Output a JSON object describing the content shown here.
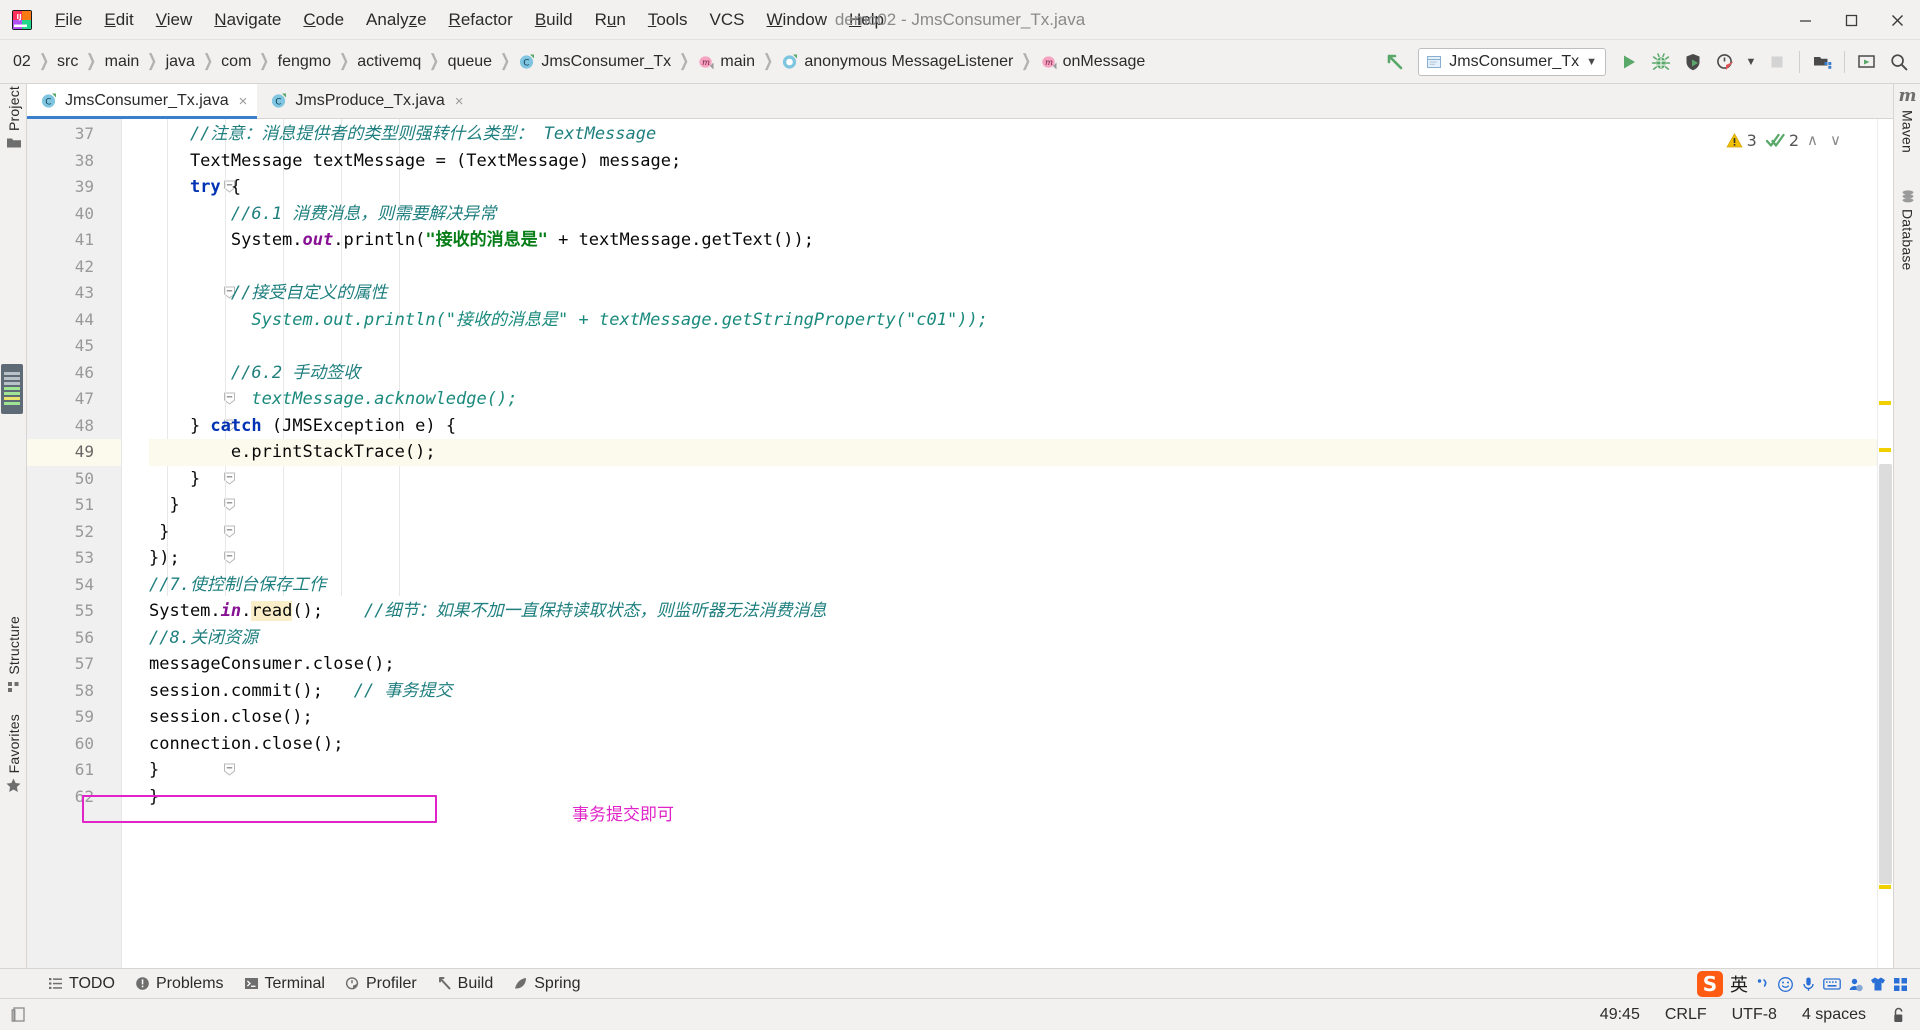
{
  "window": {
    "title": "demo02 - JmsConsumer_Tx.java",
    "logo_icon": "intellij-idea-logo",
    "minimize_icon": "—",
    "maximize_icon": "❐",
    "close_icon": "✕"
  },
  "menubar": {
    "items": [
      {
        "label": "File",
        "mnemonic": "F"
      },
      {
        "label": "Edit",
        "mnemonic": "E"
      },
      {
        "label": "View",
        "mnemonic": "V"
      },
      {
        "label": "Navigate",
        "mnemonic": "N"
      },
      {
        "label": "Code",
        "mnemonic": "C"
      },
      {
        "label": "Analyze",
        "mnemonic": "z"
      },
      {
        "label": "Refactor",
        "mnemonic": "R"
      },
      {
        "label": "Build",
        "mnemonic": "B"
      },
      {
        "label": "Run",
        "mnemonic": "u"
      },
      {
        "label": "Tools",
        "mnemonic": "T"
      },
      {
        "label": "VCS",
        "mnemonic": ""
      },
      {
        "label": "Window",
        "mnemonic": "W"
      },
      {
        "label": "Help",
        "mnemonic": "H"
      }
    ]
  },
  "breadcrumb": {
    "items": [
      {
        "label": "02",
        "icon": ""
      },
      {
        "label": "src",
        "icon": ""
      },
      {
        "label": "main",
        "icon": ""
      },
      {
        "label": "java",
        "icon": ""
      },
      {
        "label": "com",
        "icon": ""
      },
      {
        "label": "fengmo",
        "icon": ""
      },
      {
        "label": "activemq",
        "icon": ""
      },
      {
        "label": "queue",
        "icon": ""
      },
      {
        "label": "JmsConsumer_Tx",
        "icon": "class-icon"
      },
      {
        "label": "main",
        "icon": "method-icon"
      },
      {
        "label": "anonymous MessageListener",
        "icon": "anonymous-class-icon"
      },
      {
        "label": "onMessage",
        "icon": "method-icon"
      }
    ]
  },
  "toolbar": {
    "back_arrow_icon": "back-arrow-icon",
    "run_config": {
      "label": "JmsConsumer_Tx",
      "icon": "run-config-icon",
      "dropdown_icon": "▼"
    },
    "buttons": [
      {
        "name": "run-button",
        "icon": "▶",
        "color": "#59a869"
      },
      {
        "name": "debug-button",
        "icon": "bug-icon",
        "color": "#59a869"
      },
      {
        "name": "run-coverage-button",
        "icon": "coverage-icon",
        "color": "#4a4a4a"
      },
      {
        "name": "profile-button",
        "icon": "profiler-icon",
        "color": "#4a4a4a"
      },
      {
        "name": "profile-dropdown",
        "icon": "▾",
        "color": "#4a4a4a"
      },
      {
        "name": "stop-button",
        "icon": "■",
        "color": "#b0b0b0"
      },
      {
        "name": "project-structure-button",
        "icon": "project-structure-icon",
        "color": "#4a4a4a"
      },
      {
        "name": "update-project-button",
        "icon": "update-icon",
        "color": "#4a4a4a"
      },
      {
        "name": "search-everywhere-button",
        "icon": "search-icon",
        "color": "#4a4a4a"
      }
    ]
  },
  "left_tool_window": {
    "items": [
      {
        "label": "Project",
        "icon": "folder-icon"
      },
      {
        "label": "Structure",
        "icon": "structure-icon"
      },
      {
        "label": "Favorites",
        "icon": "star-icon"
      }
    ]
  },
  "right_tool_window": {
    "items": [
      {
        "label": "Maven",
        "icon": "maven-icon"
      },
      {
        "label": "Database",
        "icon": "database-icon"
      }
    ]
  },
  "editor_tabs": [
    {
      "label": "JmsConsumer_Tx.java",
      "icon": "java-class-icon",
      "active": true,
      "close_icon": "×"
    },
    {
      "label": "JmsProduce_Tx.java",
      "icon": "java-class-icon",
      "active": false,
      "close_icon": "×"
    }
  ],
  "inspections": {
    "warning_icon": "warning-triangle-icon",
    "warning_count": "3",
    "ok_icon": "double-check-icon",
    "ok_count": "2",
    "prev_icon": "∧",
    "next_icon": "∨"
  },
  "editor": {
    "first_line": 37,
    "caret_position": "49:45",
    "highlighted_line": 49,
    "lines": [
      {
        "n": 37,
        "fold": false,
        "indent": 0,
        "tokens": [
          {
            "t": "    //注意：消息提供者的类型则强转什么类型： TextMessage",
            "c": "c-cmt"
          }
        ]
      },
      {
        "n": 38,
        "fold": false,
        "indent": 0,
        "tokens": [
          {
            "t": "    TextMessage textMessage = (TextMessage) message;",
            "c": "c-txt"
          }
        ]
      },
      {
        "n": 39,
        "fold": true,
        "indent": 0,
        "tokens": [
          {
            "t": "    ",
            "c": "c-txt"
          },
          {
            "t": "try",
            "c": "c-kw"
          },
          {
            "t": " {",
            "c": "c-txt"
          }
        ]
      },
      {
        "n": 40,
        "fold": false,
        "indent": 0,
        "tokens": [
          {
            "t": "        //6.1 消费消息，则需要解决异常",
            "c": "c-cmt"
          }
        ]
      },
      {
        "n": 41,
        "fold": false,
        "indent": 0,
        "tokens": [
          {
            "t": "        System.",
            "c": "c-txt"
          },
          {
            "t": "out",
            "c": "c-fld"
          },
          {
            "t": ".println(",
            "c": "c-txt"
          },
          {
            "t": "\"接收的消息是\"",
            "c": "c-str"
          },
          {
            "t": " + textMessage.getText());",
            "c": "c-txt"
          }
        ]
      },
      {
        "n": 42,
        "fold": false,
        "indent": 0,
        "tokens": []
      },
      {
        "n": 43,
        "fold": true,
        "indent": 0,
        "tokens": [
          {
            "t": "        //接受自定义的属性",
            "c": "c-cmt"
          }
        ]
      },
      {
        "n": 44,
        "fold": false,
        "comment_marker": "//",
        "indent": 0,
        "tokens": [
          {
            "t": "          System.out.println(\"接收的消息是\" + textMessage.getStringProperty(\"c01\"));",
            "c": "c-ccode"
          }
        ]
      },
      {
        "n": 45,
        "fold": false,
        "indent": 0,
        "tokens": []
      },
      {
        "n": 46,
        "fold": false,
        "indent": 0,
        "tokens": [
          {
            "t": "        //6.2 手动签收",
            "c": "c-cmt"
          }
        ]
      },
      {
        "n": 47,
        "fold": true,
        "comment_marker": "//",
        "indent": 0,
        "tokens": [
          {
            "t": "          textMessage.acknowledge();",
            "c": "c-ccode"
          }
        ]
      },
      {
        "n": 48,
        "fold": true,
        "indent": 0,
        "tokens": [
          {
            "t": "    } ",
            "c": "c-txt"
          },
          {
            "t": "catch",
            "c": "c-kw"
          },
          {
            "t": " (JMSException e) {",
            "c": "c-txt"
          }
        ]
      },
      {
        "n": 49,
        "fold": false,
        "indent": 0,
        "tokens": [
          {
            "t": "        e.printStackTrace();",
            "c": "c-txt"
          }
        ]
      },
      {
        "n": 50,
        "fold": true,
        "indent": 0,
        "tokens": [
          {
            "t": "    }",
            "c": "c-txt"
          }
        ]
      },
      {
        "n": 51,
        "fold": true,
        "indent": 0,
        "tokens": [
          {
            "t": "  }",
            "c": "c-txt"
          }
        ]
      },
      {
        "n": 52,
        "fold": true,
        "indent": 0,
        "tokens": [
          {
            "t": " }",
            "c": "c-txt"
          }
        ]
      },
      {
        "n": 53,
        "fold": true,
        "indent": 0,
        "tokens": [
          {
            "t": "});",
            "c": "c-txt"
          }
        ]
      },
      {
        "n": 54,
        "fold": false,
        "indent": 0,
        "tokens": [
          {
            "t": "//7.使控制台保存工作",
            "c": "c-cmt"
          }
        ]
      },
      {
        "n": 55,
        "fold": false,
        "indent": 0,
        "tokens": [
          {
            "t": "System.",
            "c": "c-txt"
          },
          {
            "t": "in",
            "c": "c-fld"
          },
          {
            "t": ".",
            "c": "c-txt"
          },
          {
            "t": "read",
            "c": "c-txt hl-ident"
          },
          {
            "t": "();    ",
            "c": "c-txt"
          },
          {
            "t": "//细节：如果不加一直保持读取状态，则监听器无法消费消息",
            "c": "c-cmt"
          }
        ]
      },
      {
        "n": 56,
        "fold": false,
        "indent": 0,
        "tokens": [
          {
            "t": "//8.关闭资源",
            "c": "c-cmt"
          }
        ]
      },
      {
        "n": 57,
        "fold": false,
        "indent": 0,
        "tokens": [
          {
            "t": "messageConsumer.close();",
            "c": "c-txt"
          }
        ]
      },
      {
        "n": 58,
        "fold": false,
        "indent": 0,
        "tokens": [
          {
            "t": "session.commit();   ",
            "c": "c-txt"
          },
          {
            "t": "// 事务提交",
            "c": "c-cmt"
          }
        ]
      },
      {
        "n": 59,
        "fold": false,
        "indent": 0,
        "tokens": [
          {
            "t": "session.close();",
            "c": "c-txt"
          }
        ]
      },
      {
        "n": 60,
        "fold": false,
        "indent": 0,
        "tokens": [
          {
            "t": "connection.close();",
            "c": "c-txt"
          }
        ]
      },
      {
        "n": 61,
        "fold": true,
        "indent": 0,
        "tokens": [
          {
            "t": "}",
            "c": "c-txt"
          }
        ]
      },
      {
        "n": 62,
        "fold": false,
        "indent": 0,
        "tokens": [
          {
            "t": "}",
            "c": "c-txt"
          }
        ]
      }
    ],
    "annotation": {
      "note": "事务提交即可",
      "color": "#e024c8",
      "box_line": 58
    }
  },
  "bottom_tools": [
    {
      "label": "TODO",
      "icon": "todo-icon"
    },
    {
      "label": "Problems",
      "icon": "problems-icon"
    },
    {
      "label": "Terminal",
      "icon": "terminal-icon"
    },
    {
      "label": "Profiler",
      "icon": "profiler-icon"
    },
    {
      "label": "Build",
      "icon": "hammer-icon"
    },
    {
      "label": "Spring",
      "icon": "spring-leaf-icon"
    }
  ],
  "ime_tray": {
    "logo": "S",
    "mode": "英",
    "icons": [
      "punctuation-icon",
      "emoji-icon",
      "microphone-icon",
      "keyboard-icon",
      "user-icon",
      "skin-icon",
      "apps-icon"
    ]
  },
  "statusbar": {
    "caret": "49:45",
    "line_separator": "CRLF",
    "encoding": "UTF-8",
    "indent": "4 spaces",
    "lock_icon": "unlocked-icon",
    "left_icon": "memory-indicator-icon"
  }
}
